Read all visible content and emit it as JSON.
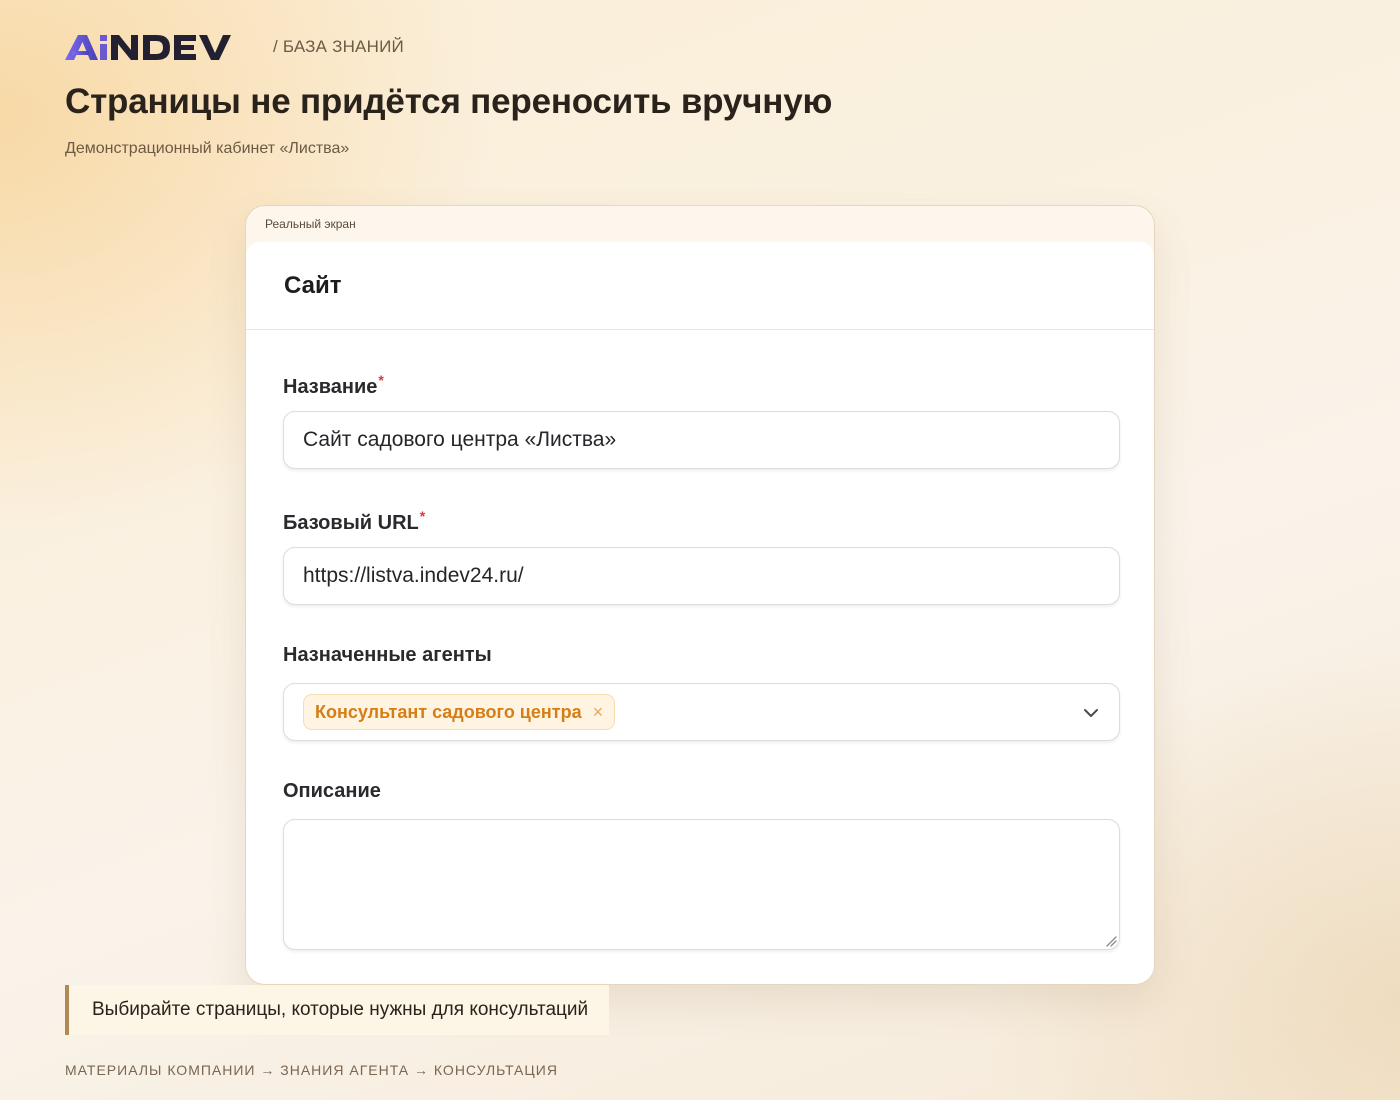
{
  "header": {
    "logo_text": "AiNDEV",
    "breadcrumb": "/ БАЗА ЗНАНИЙ",
    "title": "Страницы не придётся переносить вручную",
    "subtitle": "Демонстрационный кабинет «Листва»"
  },
  "frame": {
    "label": "Реальный экран"
  },
  "screen": {
    "title": "Сайт",
    "fields": {
      "name": {
        "label": "Название",
        "required_mark": "*",
        "value": "Сайт садового центра «Листва»"
      },
      "base_url": {
        "label": "Базовый URL",
        "required_mark": "*",
        "value": "https://listva.indev24.ru/"
      },
      "agents": {
        "label": "Назначенные агенты",
        "chips": [
          {
            "label": "Консультант садового центра",
            "remove": "×"
          }
        ]
      },
      "description": {
        "label": "Описание",
        "value": ""
      }
    }
  },
  "callout": "Выбирайте страницы, которые нужны для консультаций",
  "flow": "МАТЕРИАЛЫ КОМПАНИИ → ЗНАНИЯ АГЕНТА → КОНСУЛЬТАЦИЯ",
  "colors": {
    "accent_orange": "#d67e16",
    "chip_bg": "#fff4e2",
    "required_red": "#e0363a",
    "callout_border": "#b08a50",
    "logo_purple": "#6a5acd",
    "logo_dark": "#232032"
  },
  "icons": {
    "chip_remove": "close-icon",
    "agents_dropdown": "chevron-down-icon",
    "textarea_resize": "resize-grip-icon"
  }
}
